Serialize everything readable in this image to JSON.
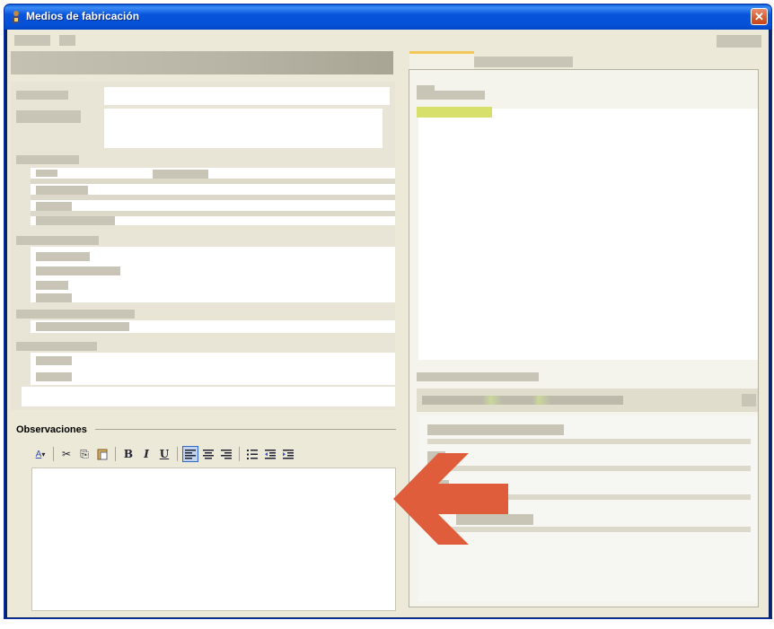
{
  "window": {
    "title": "Medios de fabricación",
    "close_glyph": "✕"
  },
  "observaciones": {
    "label": "Observaciones",
    "text": ""
  },
  "toolbar": {
    "buttons": [
      {
        "name": "font-color-icon",
        "glyph": "A",
        "active": false
      },
      {
        "name": "cut-icon",
        "glyph": "✂",
        "active": false
      },
      {
        "name": "copy-icon",
        "glyph": "⎘",
        "active": false
      },
      {
        "name": "paste-icon",
        "glyph": "📋",
        "active": false
      },
      {
        "name": "bold-icon",
        "glyph": "B",
        "active": false
      },
      {
        "name": "italic-icon",
        "glyph": "I",
        "active": false
      },
      {
        "name": "underline-icon",
        "glyph": "U",
        "active": false
      },
      {
        "name": "align-left-icon",
        "glyph": "≡",
        "active": true
      },
      {
        "name": "align-center-icon",
        "glyph": "≡",
        "active": false
      },
      {
        "name": "align-right-icon",
        "glyph": "≡",
        "active": false
      },
      {
        "name": "bullet-list-icon",
        "glyph": "☰",
        "active": false
      },
      {
        "name": "outdent-icon",
        "glyph": "⇤",
        "active": false
      },
      {
        "name": "indent-icon",
        "glyph": "⇥",
        "active": false
      }
    ]
  },
  "colors": {
    "titlebar": "#0451d6",
    "client_bg": "#ece9d8",
    "close_button": "#d65a2c",
    "arrow": "#e05d3c",
    "tab_highlight": "#f2c85a"
  }
}
